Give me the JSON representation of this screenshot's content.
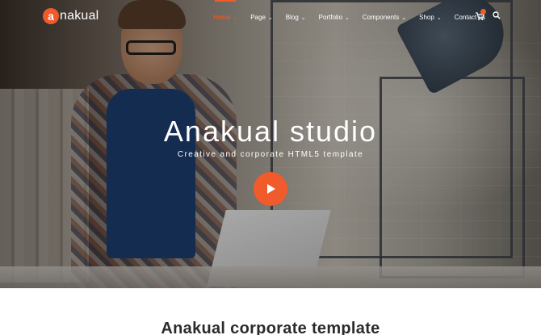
{
  "brand": {
    "logo_letter": "a",
    "logo_rest": "nakual",
    "accent_color": "#f15a2b"
  },
  "nav": {
    "items": [
      {
        "label": "Home",
        "has_dropdown": true,
        "active": true
      },
      {
        "label": "Page",
        "has_dropdown": true,
        "active": false
      },
      {
        "label": "Blog",
        "has_dropdown": true,
        "active": false
      },
      {
        "label": "Portfolio",
        "has_dropdown": true,
        "active": false
      },
      {
        "label": "Components",
        "has_dropdown": true,
        "active": false
      },
      {
        "label": "Shop",
        "has_dropdown": true,
        "active": false
      },
      {
        "label": "Contact us",
        "has_dropdown": false,
        "active": false
      }
    ],
    "cart_icon": "cart-icon",
    "search_icon": "search-icon"
  },
  "hero": {
    "title": "Anakual studio",
    "subtitle": "Creative and corporate HTML5 template",
    "play_icon": "play-icon"
  },
  "section": {
    "title": "Anakual corporate template"
  }
}
